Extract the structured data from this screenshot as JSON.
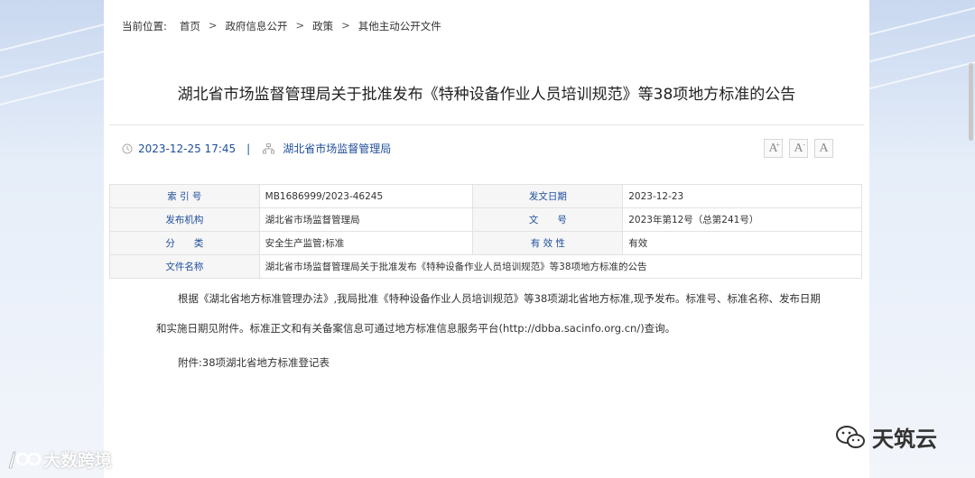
{
  "breadcrumb": {
    "prefix": "当前位置:",
    "items": [
      "首页",
      "政府信息公开",
      "政策",
      "其他主动公开文件"
    ],
    "separator": ">"
  },
  "article": {
    "title": "湖北省市场监督管理局关于批准发布《特种设备作业人员培训规范》等38项地方标准的公告",
    "datetime": "2023-12-25 17:45",
    "divider": "|",
    "publisher": "湖北省市场监督管理局"
  },
  "font_buttons": {
    "large": "A",
    "medium": "A",
    "small": "A",
    "plus": "+",
    "minus": "-"
  },
  "info_table": {
    "rows": [
      {
        "k1": "索 引 号",
        "v1": "MB1686999/2023-46245",
        "k2": "发文日期",
        "v2": "2023-12-23"
      },
      {
        "k1": "发布机构",
        "v1": "湖北省市场监督管理局",
        "k2": "文　　号",
        "v2": "2023年第12号（总第241号）"
      },
      {
        "k1": "分　　类",
        "v1": "安全生产监管;标准",
        "k2": "有 效 性",
        "v2": "有效"
      }
    ],
    "filename_label": "文件名称",
    "filename_value": "湖北省市场监督管理局关于批准发布《特种设备作业人员培训规范》等38项地方标准的公告"
  },
  "content": {
    "para1_line1": "根据《湖北省地方标准管理办法》,我局批准《特种设备作业人员培训规范》等38项湖北省地方标准,现予发布。标准号、标准名称、发布日期",
    "para1_line2": "和实施日期见附件。标准正文和有关备案信息可通过地方标准信息服务平台(http://dbba.sacinfo.org.cn/)查询。",
    "attachment": "附件:38项湖北省地方标准登记表"
  },
  "watermarks": {
    "left": "大数跨境",
    "right": "天筑云"
  }
}
